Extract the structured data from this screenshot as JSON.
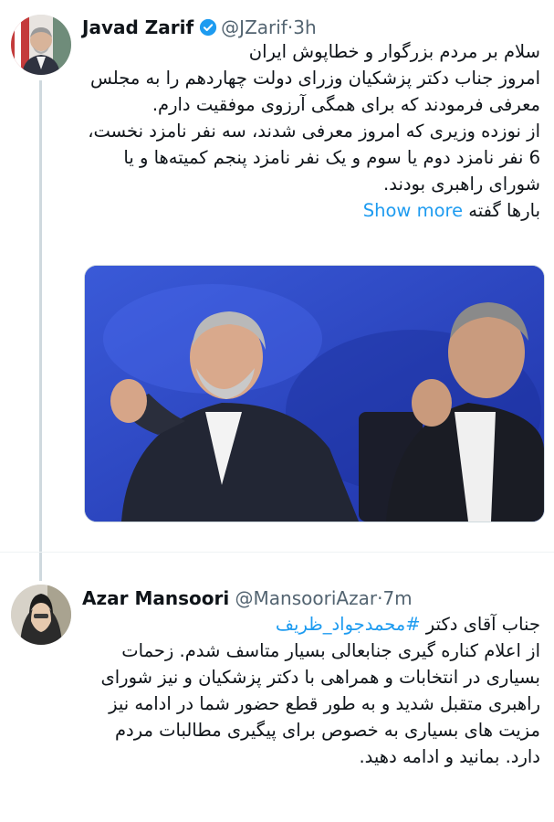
{
  "tweets": [
    {
      "author_name": "Javad Zarif",
      "handle": "@JZarif",
      "separator": "·",
      "time": "3h",
      "verified": true,
      "text_lines": [
        "سلام بر مردم بزرگوار و خطاپوش ایران",
        "امروز جناب دکتر پزشکیان وزرای دولت چهاردهم را به مجلس معرفی فرمودند که برای همگی آرزوی موفقیت دارم.",
        "از نوزده وزیری که امروز معرفی شدند، سه نفر نامزد نخست، 6 نفر نامزد دوم یا سوم و یک نفر نامزد پنجم کمیته‌ها و یا شورای راهبری بودند."
      ],
      "last_line_prefix": "بارها گفته",
      "show_more_label": "Show more",
      "avatar_icon": "person-photo-icon",
      "media_icon": "photo-icon"
    },
    {
      "author_name": "Azar Mansoori",
      "handle": "@MansooriAzar",
      "separator": "·",
      "time": "7m",
      "verified": false,
      "text_intro": "جناب آقای دکتر ",
      "hashtag": "#محمدجواد_ظریف",
      "text_rest": "از اعلام کناره گیری جنابعالی بسیار متاسف شدم. زحمات بسیاری در انتخابات و همراهی با دکتر پزشکیان و نیز شورای راهبری متقبل شدید و به طور قطع حضور شما در ادامه نیز مزیت های بسیاری به خصوص برای پیگیری مطالبات مردم دارد. بمانید و ادامه دهید.",
      "avatar_icon": "person-photo-icon"
    }
  ],
  "colors": {
    "link": "#1d9bf0",
    "secondary_text": "#536471",
    "thread_line": "#cfd9de",
    "verified": "#1d9bf0",
    "photo_background": "#2b46c8"
  }
}
